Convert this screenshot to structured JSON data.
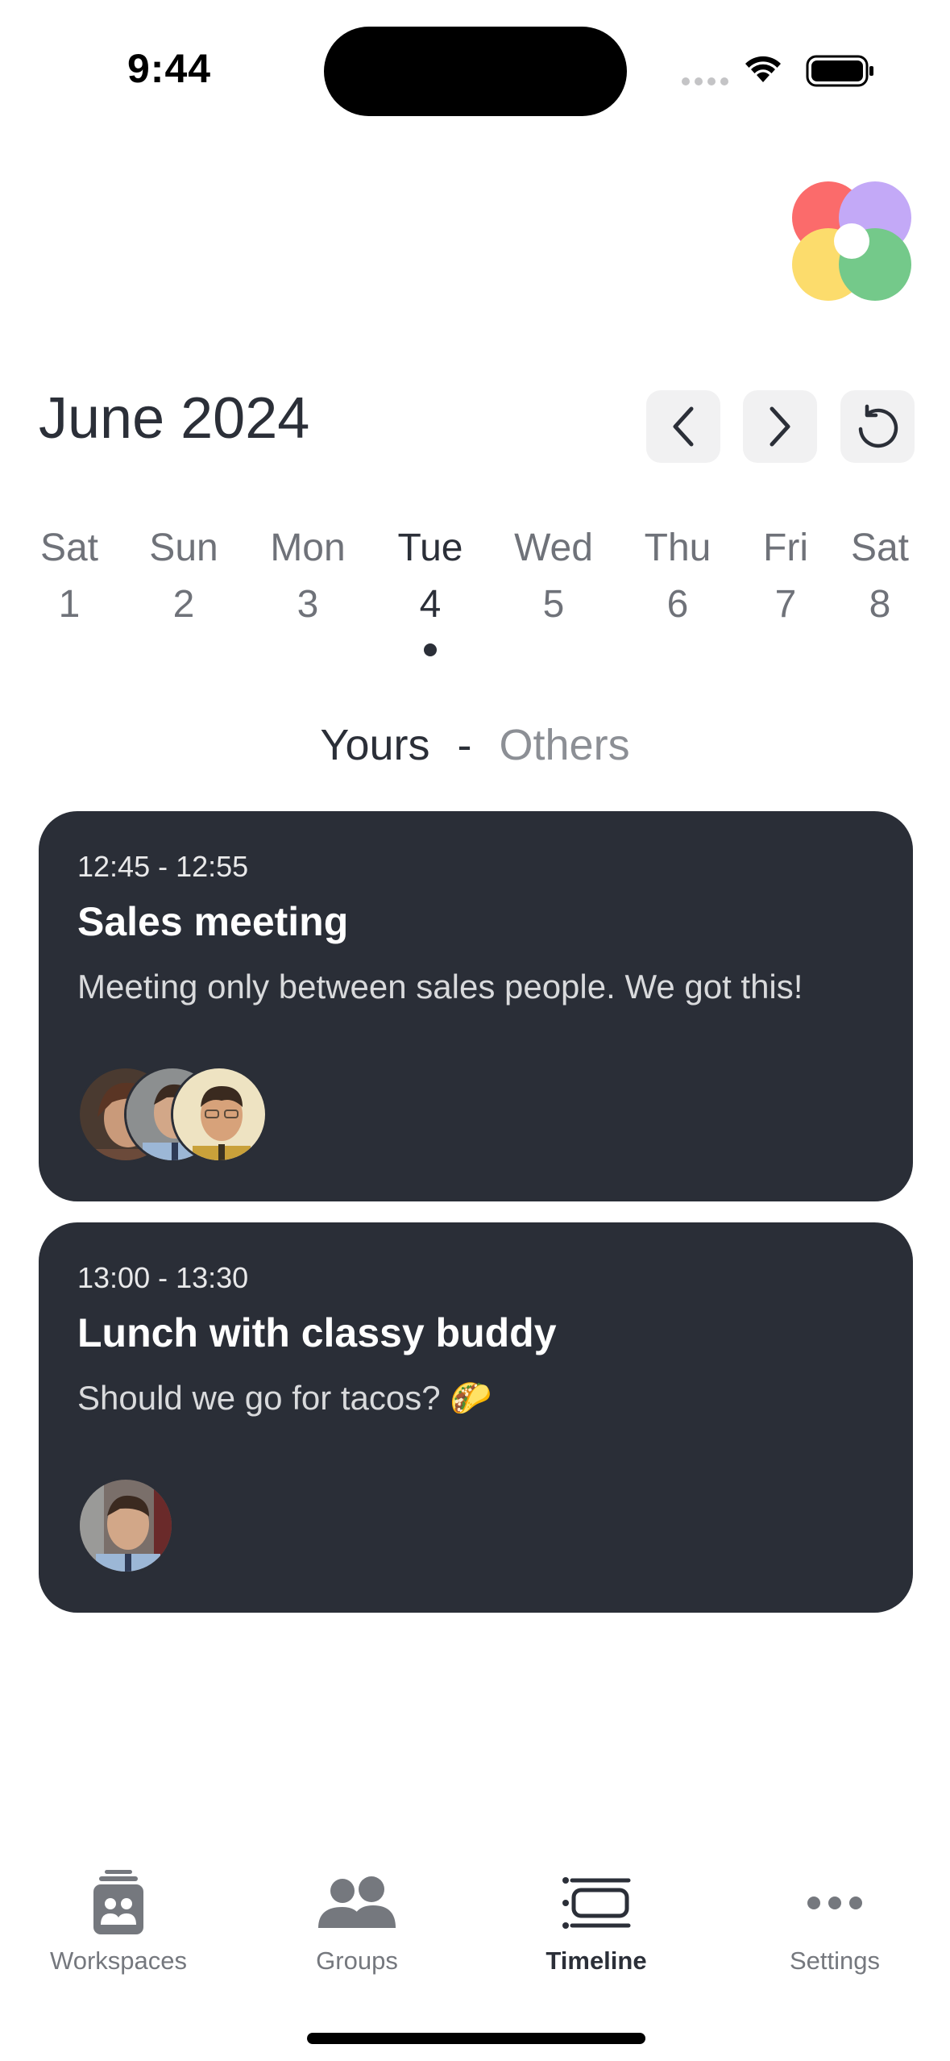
{
  "status_bar": {
    "time": "9:44"
  },
  "header": {
    "month": "June 2024"
  },
  "nav": {
    "prev_icon": "chevron-left-icon",
    "next_icon": "chevron-right-icon",
    "reset_icon": "rotate-ccw-icon"
  },
  "week": {
    "days": [
      {
        "name": "Sat",
        "num": "1"
      },
      {
        "name": "Sun",
        "num": "2"
      },
      {
        "name": "Mon",
        "num": "3"
      },
      {
        "name": "Tue",
        "num": "4"
      },
      {
        "name": "Wed",
        "num": "5"
      },
      {
        "name": "Thu",
        "num": "6"
      },
      {
        "name": "Fri",
        "num": "7"
      },
      {
        "name": "Sat",
        "num": "8"
      }
    ],
    "selected": "Tue 4"
  },
  "segment": {
    "yours": "Yours",
    "separator": "-",
    "others": "Others",
    "selected": "Yours"
  },
  "events": [
    {
      "time": "12:45 - 12:55",
      "title": "Sales meeting",
      "description": "Meeting only between sales people. We got this!"
    },
    {
      "time": "13:00 - 13:30",
      "title": "Lunch with classy buddy",
      "description": "Should we go for tacos? 🌮"
    }
  ],
  "tabs": [
    {
      "label": "Workspaces",
      "icon": "workspaces-icon"
    },
    {
      "label": "Groups",
      "icon": "groups-icon"
    },
    {
      "label": "Timeline",
      "icon": "timeline-icon"
    },
    {
      "label": "Settings",
      "icon": "more-dots-icon"
    }
  ],
  "active_tab": "Timeline",
  "colors": {
    "card_bg": "#2a2e37",
    "text_primary": "#2b2f38",
    "text_muted": "#8c8f95"
  }
}
